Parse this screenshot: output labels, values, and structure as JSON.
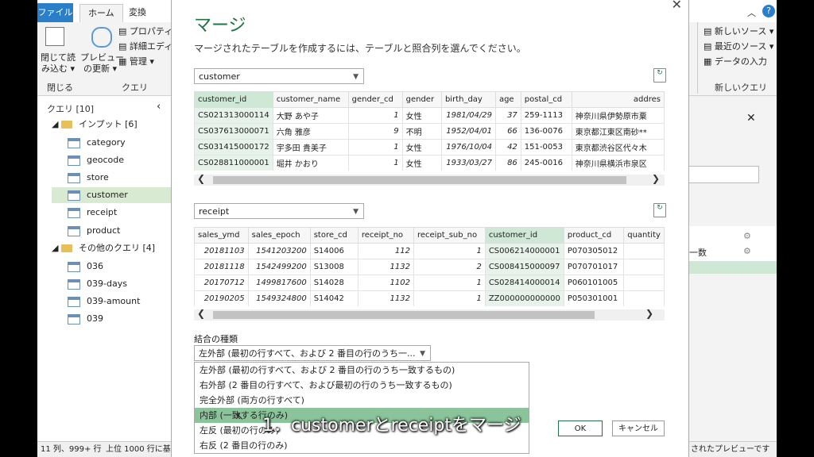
{
  "ribbon": {
    "tabs": [
      "ファイル",
      "ホーム",
      "変換"
    ],
    "close_load": "閉じて読\nみ込む ▾",
    "group_close": "閉じる",
    "refresh": "プレビュー\nの更新 ▾",
    "properties": "プロパティ",
    "advanced_editor": "詳細エディタ",
    "manage": "管理 ▾",
    "group_query": "クエリ",
    "new_source": "新しいソース ▾",
    "recent_source": "最近のソース ▾",
    "enter_data": "データの入力",
    "group_new_query": "新しいクエリ"
  },
  "left_pane": {
    "title": "クエリ [10]",
    "folder_import": "インプット [6]",
    "import_items": [
      "category",
      "geocode",
      "store",
      "customer",
      "receipt",
      "product"
    ],
    "folder_other": "その他のクエリ [4]",
    "other_items": [
      "036",
      "039-days",
      "039-amount",
      "039"
    ]
  },
  "right_pane": {
    "item": "一数"
  },
  "statusbar": {
    "left": "11 列、999+ 行",
    "mid": "上位 1000 行に基づ",
    "right": "されたプレビューです"
  },
  "dialog": {
    "title": "マージ",
    "subtitle": "マージされたテーブルを作成するには、テーブルと照合列を選んでください。",
    "table1": {
      "select": "customer",
      "headers": [
        "customer_id",
        "customer_name",
        "gender_cd",
        "gender",
        "birth_day",
        "age",
        "postal_cd",
        "addres"
      ],
      "rows": [
        [
          "CS021313000114",
          "大野 あや子",
          "1",
          "女性",
          "1981/04/29",
          "37",
          "259-1113",
          "神奈川県伊勢原市粟"
        ],
        [
          "CS037613000071",
          "六角 雅彦",
          "9",
          "不明",
          "1952/04/01",
          "66",
          "136-0076",
          "東京都江東区南砂**"
        ],
        [
          "CS031415000172",
          "宇多田 貴美子",
          "1",
          "女性",
          "1976/10/04",
          "42",
          "151-0053",
          "東京都渋谷区代々木"
        ],
        [
          "CS028811000001",
          "堀井 かおり",
          "1",
          "女性",
          "1933/03/27",
          "86",
          "245-0016",
          "神奈川県横浜市泉区"
        ]
      ]
    },
    "table2": {
      "select": "receipt",
      "headers": [
        "sales_ymd",
        "sales_epoch",
        "store_cd",
        "receipt_no",
        "receipt_sub_no",
        "customer_id",
        "product_cd",
        "quantity"
      ],
      "rows": [
        [
          "20181103",
          "1541203200",
          "S14006",
          "112",
          "1",
          "CS006214000001",
          "P070305012",
          ""
        ],
        [
          "20181118",
          "1542499200",
          "S13008",
          "1132",
          "2",
          "CS008415000097",
          "P070701017",
          ""
        ],
        [
          "20170712",
          "1499817600",
          "S14028",
          "1102",
          "1",
          "CS028414000014",
          "P060101005",
          ""
        ],
        [
          "20190205",
          "1549324800",
          "S14042",
          "1132",
          "1",
          "ZZ000000000000",
          "P050301001",
          ""
        ]
      ]
    },
    "join_label": "結合の種類",
    "join_selected": "左外部 (最初の行すべて、および 2 番目の行のうち一...",
    "join_options": [
      "左外部 (最初の行すべて、および 2 番目の行のうち一致するもの)",
      "右外部 (2 番目の行すべて、および最初の行のうち一致するもの)",
      "完全外部 (両方の行すべて)",
      "内部 (一致する行のみ)",
      "左反 (最初の行のみ)",
      "右反 (2 番目の行のみ)"
    ],
    "ok": "OK",
    "cancel": "キャンセル"
  },
  "caption": "1．customerとreceiptをマージ"
}
